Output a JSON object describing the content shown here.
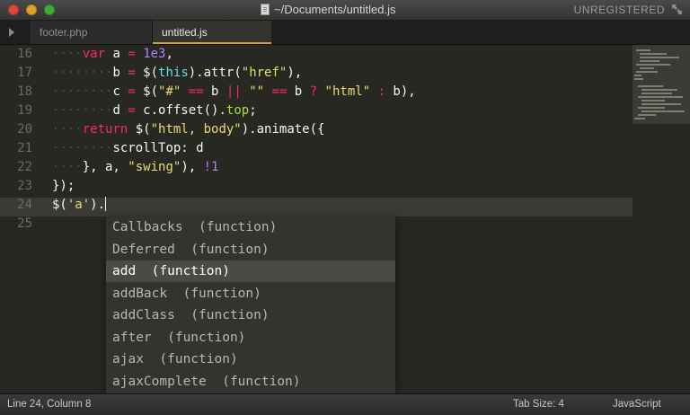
{
  "window": {
    "title": "~/Documents/untitled.js",
    "license_label": "UNREGISTERED"
  },
  "tabs": [
    {
      "label": "footer.php",
      "active": false
    },
    {
      "label": "untitled.js",
      "active": true
    }
  ],
  "editor": {
    "line_numbers": [
      "16",
      "17",
      "18",
      "19",
      "20",
      "21",
      "22",
      "23",
      "24",
      "25"
    ],
    "current_line": "24",
    "lines": [
      "    var a = 1e3,",
      "        b = $(this).attr(\"href\"),",
      "        c = $(\"#\" == b || \"\" == b ? \"html\" : b),",
      "        d = c.offset().top;",
      "    return $(\"html, body\").animate({",
      "        scrollTop: d",
      "    }, a, \"swing\"), !1",
      "});",
      "$('a').",
      ""
    ]
  },
  "autocomplete": {
    "selected_index": 2,
    "items": [
      {
        "name": "Callbacks",
        "kind": "(function)"
      },
      {
        "name": "Deferred",
        "kind": "(function)"
      },
      {
        "name": "add",
        "kind": "(function)"
      },
      {
        "name": "addBack",
        "kind": "(function)"
      },
      {
        "name": "addClass",
        "kind": "(function)"
      },
      {
        "name": "after",
        "kind": "(function)"
      },
      {
        "name": "ajax",
        "kind": "(function)"
      },
      {
        "name": "ajaxComplete",
        "kind": "(function)"
      }
    ]
  },
  "status": {
    "position": "Line 24, Column 8",
    "tab_size": "Tab Size: 4",
    "syntax": "JavaScript"
  },
  "icons": {
    "close_light": "close-icon",
    "minimize_light": "minimize-icon",
    "zoom_light": "zoom-icon",
    "document": "document-icon",
    "fullscreen": "fullscreen-icon",
    "sidebar_toggle": "play-icon"
  },
  "colors": {
    "background": "#272822",
    "keyword": "#f92672",
    "string": "#e6db74",
    "number": "#ae81ff",
    "function": "#66d9ef",
    "property": "#a6e22e",
    "tab_accent": "#e09a3c"
  }
}
